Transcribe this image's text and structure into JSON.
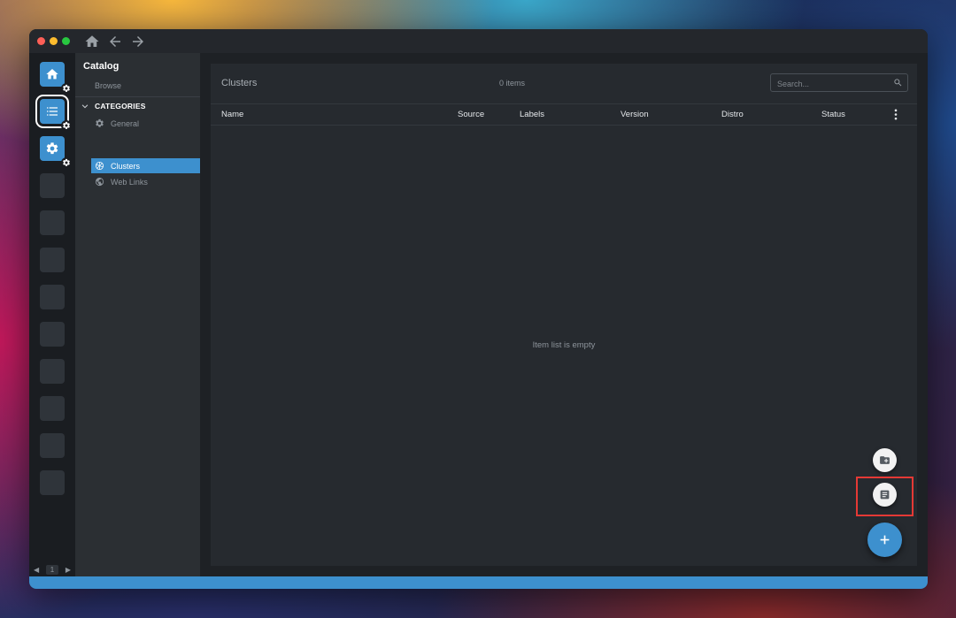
{
  "titlebar": {
    "icons": {
      "home": "home-icon",
      "back": "arrow-back-icon",
      "forward": "arrow-forward-icon"
    }
  },
  "hotbar": {
    "items": [
      {
        "icon": "home-icon",
        "badge": "gear-icon",
        "filled": true,
        "active": false
      },
      {
        "icon": "list-icon",
        "badge": "gear-icon",
        "filled": true,
        "active": true
      },
      {
        "icon": "gear-icon",
        "badge": "gear-icon",
        "filled": true,
        "active": false
      }
    ],
    "empty_slots": 9,
    "pager": {
      "page": "1"
    }
  },
  "catalog": {
    "title": "Catalog",
    "browse_label": "Browse",
    "categories_label": "CATEGORIES",
    "items": [
      {
        "label": "General",
        "icon": "gear-icon",
        "selected": false
      },
      {
        "label": "Clusters",
        "icon": "kubernetes-icon",
        "selected": true
      },
      {
        "label": "Web Links",
        "icon": "globe-icon",
        "selected": false
      }
    ]
  },
  "main": {
    "title": "Clusters",
    "item_count": "0 items",
    "search": {
      "placeholder": "Search...",
      "value": ""
    },
    "columns": [
      "Name",
      "Source",
      "Labels",
      "Version",
      "Distro",
      "Status"
    ],
    "empty_message": "Item list is empty"
  },
  "fab": {
    "actions": [
      {
        "icon": "folder-add-icon"
      },
      {
        "icon": "document-icon"
      }
    ],
    "main_icon": "plus-icon"
  },
  "colors": {
    "accent": "#3d90ce",
    "highlight": "#e53935"
  }
}
